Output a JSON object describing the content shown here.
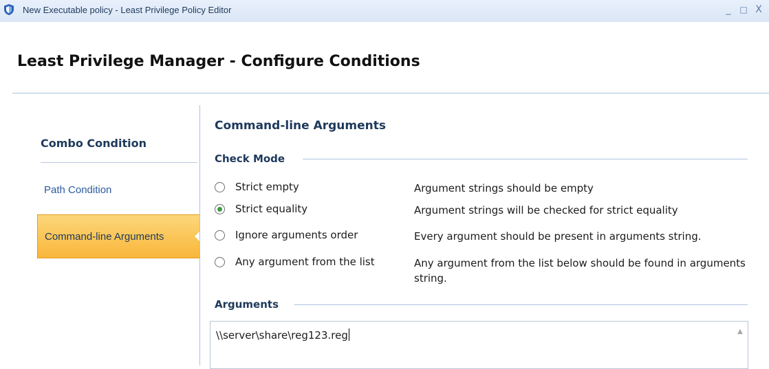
{
  "window": {
    "title": "New Executable policy - Least Privilege Policy Editor",
    "minimize_label": "_",
    "maximize_label": "□",
    "close_label": "X"
  },
  "page_title": "Least Privilege Manager - Configure Conditions",
  "sidebar": {
    "items": [
      {
        "label": "Combo Condition"
      },
      {
        "label": "Path Condition"
      },
      {
        "label": "Command-line Arguments",
        "selected": true
      }
    ]
  },
  "main": {
    "section_title": "Command-line Arguments",
    "check_mode": {
      "label": "Check Mode",
      "options": [
        {
          "label": "Strict empty",
          "description": "Argument strings should be empty",
          "checked": false
        },
        {
          "label": "Strict equality",
          "description": "Argument strings will be checked for strict equality",
          "checked": true
        },
        {
          "label": "Ignore arguments order",
          "description": "Every argument should be present in arguments string.",
          "checked": false
        },
        {
          "label": "Any argument from the list",
          "description": "Any argument from the list below should be found in arguments string.",
          "checked": false
        }
      ]
    },
    "arguments": {
      "label": "Arguments",
      "value": "\\\\server\\share\\reg123.reg"
    }
  },
  "icons": {
    "app": "shield-icon",
    "scroll_up": "chevron-up-icon"
  },
  "colors": {
    "accent": "#1e395b",
    "selected_nav": "#f9b63a",
    "link": "#2c5aa0"
  }
}
